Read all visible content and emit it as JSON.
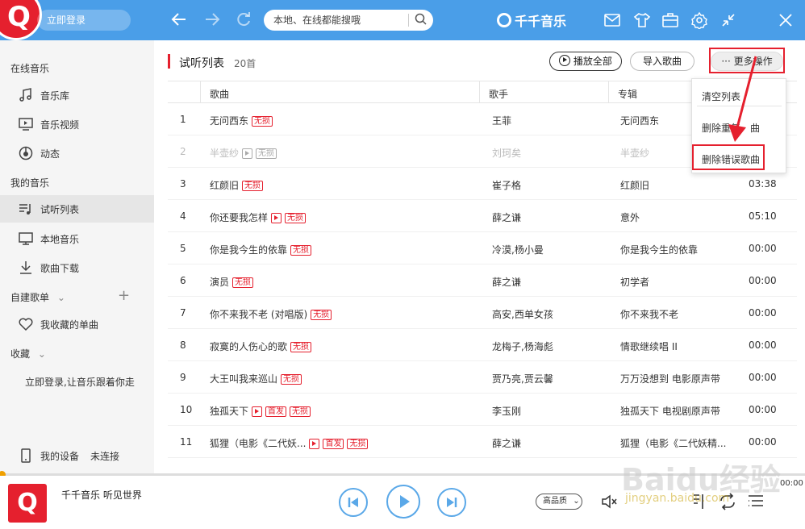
{
  "titlebar": {
    "login_label": "立即登录",
    "search_placeholder": "本地、在线都能搜哦",
    "brand": "千千音乐",
    "icons": [
      "back-arrow-icon",
      "forward-arrow-icon",
      "refresh-icon",
      "search-icon",
      "mail-icon",
      "shirt-icon",
      "toolbox-icon",
      "settings-icon",
      "minimize-icon",
      "close-icon"
    ]
  },
  "sidebar": {
    "online_head": "在线音乐",
    "online_items": [
      "音乐库",
      "音乐视频",
      "动态"
    ],
    "my_head": "我的音乐",
    "my_items": [
      "试听列表",
      "本地音乐",
      "歌曲下载"
    ],
    "custom_head": "自建歌单",
    "fav_item": "我收藏的单曲",
    "collect_head": "收藏",
    "login_prompt": "立即登录,让音乐跟着你走",
    "device_label": "我的设备",
    "device_status": "未连接"
  },
  "list": {
    "title": "试听列表",
    "count": "20首",
    "play_all": "播放全部",
    "import": "导入歌曲",
    "more": "更多操作",
    "columns": [
      "歌曲",
      "歌手",
      "专辑"
    ]
  },
  "dropdown": {
    "items": [
      "清空列表",
      "删除重复歌曲",
      "删除错误歌曲"
    ],
    "item2_visible": "删除重复",
    "item2_tail": "曲"
  },
  "rows": [
    {
      "no": "1",
      "song": "无问西东",
      "tags": [
        "无损"
      ],
      "video": false,
      "artist": "王菲",
      "album": "无问西东",
      "time": "",
      "dim": false
    },
    {
      "no": "2",
      "song": "半壶纱",
      "tags": [
        "无损"
      ],
      "video": true,
      "artist": "刘珂矣",
      "album": "半壶纱",
      "time": "",
      "dim": true
    },
    {
      "no": "3",
      "song": "红颜旧",
      "tags": [
        "无损"
      ],
      "video": false,
      "artist": "崔子格",
      "album": "红颜旧",
      "time": "03:38",
      "dim": false
    },
    {
      "no": "4",
      "song": "你还要我怎样",
      "tags": [
        "无损"
      ],
      "video": true,
      "artist": "薛之谦",
      "album": "意外",
      "time": "05:10",
      "dim": false
    },
    {
      "no": "5",
      "song": "你是我今生的依靠",
      "tags": [
        "无损"
      ],
      "video": false,
      "artist": "冷漠,杨小曼",
      "album": "你是我今生的依靠",
      "time": "00:00",
      "dim": false
    },
    {
      "no": "6",
      "song": "演员",
      "tags": [
        "无损"
      ],
      "video": false,
      "artist": "薛之谦",
      "album": "初学者",
      "time": "00:00",
      "dim": false
    },
    {
      "no": "7",
      "song": "你不来我不老 (对唱版)",
      "tags": [
        "无损"
      ],
      "video": false,
      "artist": "高安,西单女孩",
      "album": "你不来我不老",
      "time": "00:00",
      "dim": false
    },
    {
      "no": "8",
      "song": "寂寞的人伤心的歌",
      "tags": [
        "无损"
      ],
      "video": false,
      "artist": "龙梅子,杨海彪",
      "album": "情歌继续唱 II",
      "time": "00:00",
      "dim": false
    },
    {
      "no": "9",
      "song": "大王叫我来巡山",
      "tags": [
        "无损"
      ],
      "video": false,
      "artist": "贾乃亮,贾云馨",
      "album": "万万没想到 电影原声带",
      "time": "00:00",
      "dim": false
    },
    {
      "no": "10",
      "song": "独孤天下",
      "tags": [
        "首发",
        "无损"
      ],
      "video": true,
      "artist": "李玉刚",
      "album": "独孤天下 电视剧原声带",
      "time": "00:00",
      "dim": false
    },
    {
      "no": "11",
      "song": "狐狸（电影《二代妖...",
      "tags": [
        "首发",
        "无损"
      ],
      "video": true,
      "artist": "薛之谦",
      "album": "狐狸（电影《二代妖精...",
      "time": "00:00",
      "dim": false
    }
  ],
  "player": {
    "title": "千千音乐 听见世界",
    "time": "00:00",
    "quality": "高品质",
    "watermark": "Baidu经验",
    "watermark_sub": "jingyan.baidu.com"
  },
  "colors": {
    "accent_blue": "#4a9ee8",
    "accent_red": "#e5202e",
    "control_blue": "#5aa8e8"
  }
}
